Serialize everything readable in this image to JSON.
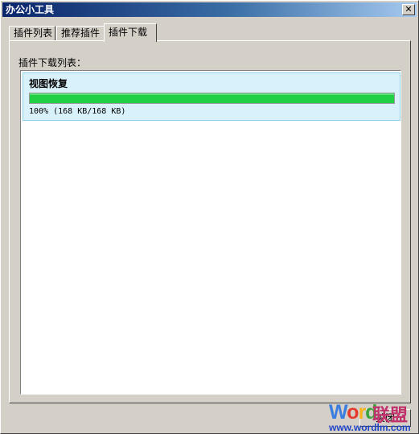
{
  "window": {
    "title": "办公小工具",
    "close_glyph": "✕"
  },
  "tabs": [
    {
      "label": "插件列表",
      "active": false
    },
    {
      "label": "推荐插件",
      "active": false
    },
    {
      "label": "插件下载",
      "active": true
    }
  ],
  "download_list": {
    "label": "插件下载列表：",
    "items": [
      {
        "name": "视图恢复",
        "progress": 1.0,
        "status": "100% (168 KB/168 KB)"
      }
    ]
  },
  "footer": {
    "close_label": "关闭"
  },
  "watermark": {
    "brand": "Word",
    "brand_cn": "联盟",
    "url": "www.wordlm.com"
  },
  "colors": {
    "progress_fill": "#1fd143",
    "item_highlight": "#d9f1fa",
    "title_gradient_start": "#0a246a"
  }
}
